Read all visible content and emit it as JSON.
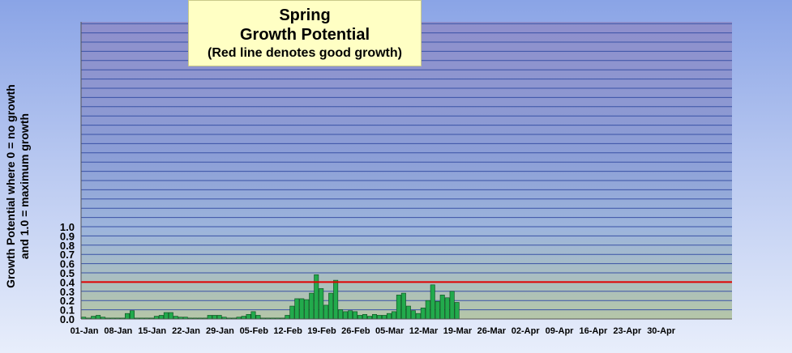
{
  "chart_data": {
    "type": "bar",
    "title_lines": [
      "Spring",
      "Growth Potential",
      "(Red line denotes good growth)"
    ],
    "ylabel_lines": [
      "Growth Potential where 0 = no growth",
      "and 1.0 = maximum growth"
    ],
    "ylim": [
      0,
      1.0
    ],
    "y_ticks": [
      "0.0",
      "0.1",
      "0.2",
      "0.3",
      "0.4",
      "0.5",
      "0.6",
      "0.7",
      "0.8",
      "0.9",
      "1.0"
    ],
    "x_tick_labels": [
      "01-Jan",
      "08-Jan",
      "15-Jan",
      "22-Jan",
      "29-Jan",
      "05-Feb",
      "12-Feb",
      "19-Feb",
      "26-Feb",
      "05-Mar",
      "12-Mar",
      "19-Mar",
      "26-Mar",
      "02-Apr",
      "09-Apr",
      "16-Apr",
      "23-Apr",
      "30-Apr"
    ],
    "threshold": 0.4,
    "threshold_color": "#e00000",
    "bar_color": "#22aa4c",
    "values": [
      0.02,
      0.01,
      0.03,
      0.04,
      0.02,
      0.01,
      0.01,
      0.01,
      0.01,
      0.06,
      0.09,
      0.01,
      0.01,
      0.01,
      0.01,
      0.03,
      0.04,
      0.07,
      0.07,
      0.03,
      0.02,
      0.02,
      0.01,
      0.01,
      0.01,
      0.01,
      0.04,
      0.04,
      0.04,
      0.02,
      0.01,
      0.01,
      0.02,
      0.03,
      0.05,
      0.08,
      0.04,
      0.01,
      0.01,
      0.01,
      0.01,
      0.01,
      0.04,
      0.14,
      0.22,
      0.22,
      0.21,
      0.28,
      0.48,
      0.33,
      0.15,
      0.28,
      0.42,
      0.1,
      0.08,
      0.09,
      0.08,
      0.04,
      0.05,
      0.03,
      0.05,
      0.04,
      0.04,
      0.06,
      0.08,
      0.26,
      0.28,
      0.14,
      0.09,
      0.06,
      0.12,
      0.2,
      0.37,
      0.19,
      0.26,
      0.23,
      0.3,
      0.18
    ]
  }
}
